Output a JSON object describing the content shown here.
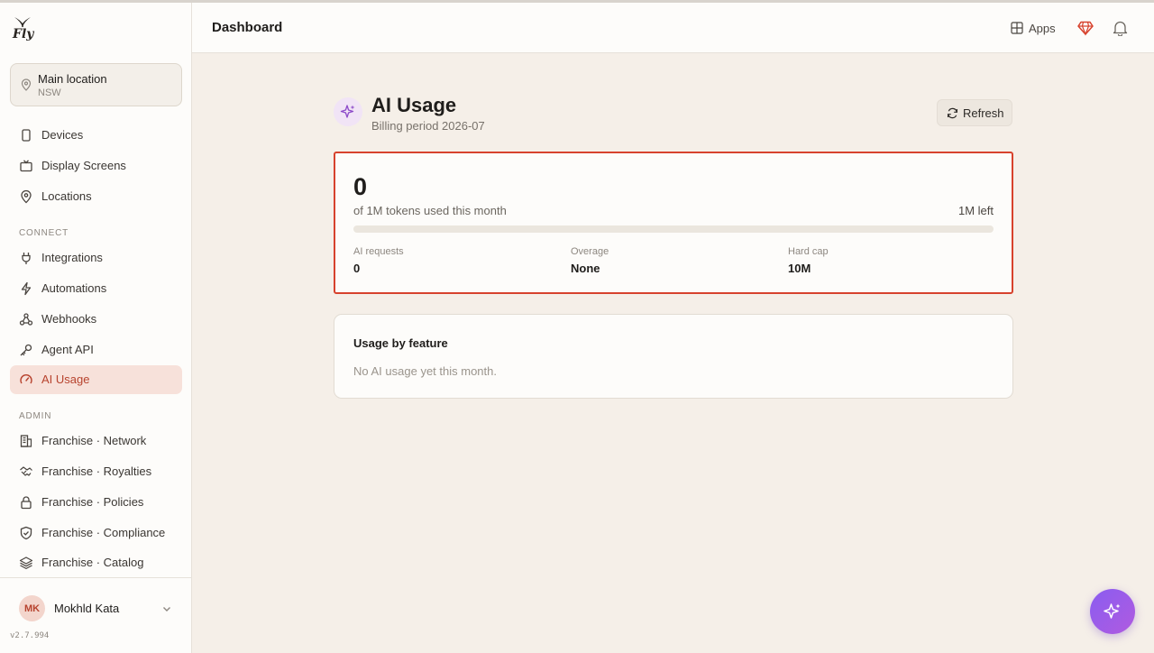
{
  "app": {
    "logo_text": "Fly"
  },
  "sidebar": {
    "location": {
      "title": "Main location",
      "subtitle": "NSW"
    },
    "items": [
      {
        "label": "Devices",
        "icon": "phone-icon"
      },
      {
        "label": "Display Screens",
        "icon": "tv-icon"
      },
      {
        "label": "Locations",
        "icon": "map-pin-icon"
      }
    ],
    "connect_label": "CONNECT",
    "connect_items": [
      {
        "label": "Integrations",
        "icon": "plug-icon"
      },
      {
        "label": "Automations",
        "icon": "lightning-icon"
      },
      {
        "label": "Webhooks",
        "icon": "webhook-icon"
      },
      {
        "label": "Agent API",
        "icon": "key-icon"
      },
      {
        "label": "AI Usage",
        "icon": "gauge-icon",
        "active": true
      }
    ],
    "admin_label": "ADMIN",
    "admin_items": [
      {
        "label": "Franchise · Network",
        "icon": "building-icon"
      },
      {
        "label": "Franchise · Royalties",
        "icon": "handshake-icon"
      },
      {
        "label": "Franchise · Policies",
        "icon": "lock-icon"
      },
      {
        "label": "Franchise · Compliance",
        "icon": "shield-icon"
      },
      {
        "label": "Franchise · Catalog",
        "icon": "layers-icon"
      }
    ],
    "user": {
      "initials": "MK",
      "name": "Mokhld Kata"
    },
    "version": "v2.7.994"
  },
  "header": {
    "title": "Dashboard",
    "apps_label": "Apps"
  },
  "main": {
    "title": "AI Usage",
    "subtitle": "Billing period 2026-07",
    "refresh_label": "Refresh",
    "usage": {
      "tokens_used": "0",
      "tokens_caption": "of 1M tokens used this month",
      "tokens_left": "1M left",
      "progress_fraction": 0,
      "stats": [
        {
          "label": "AI requests",
          "value": "0"
        },
        {
          "label": "Overage",
          "value": "None"
        },
        {
          "label": "Hard cap",
          "value": "10M"
        }
      ]
    },
    "feature_card": {
      "title": "Usage by feature",
      "empty_text": "No AI usage yet this month."
    }
  },
  "colors": {
    "accent": "#d7422d",
    "fab": "#9b5cf0",
    "active_bg": "#f7e1da"
  }
}
